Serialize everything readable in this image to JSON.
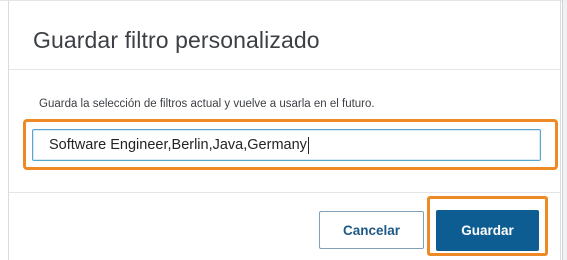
{
  "dialog": {
    "title": "Guardar filtro personalizado",
    "description": "Guarda la selección de filtros actual y vuelve a usarla en el futuro.",
    "filter_name_value": "Software Engineer,Berlin,Java,Germany",
    "cancel_label": "Cancelar",
    "save_label": "Guardar"
  },
  "colors": {
    "highlight": "#ee8a25",
    "primary_button": "#0e5d92",
    "input_focus_border": "#5aa6cf"
  }
}
